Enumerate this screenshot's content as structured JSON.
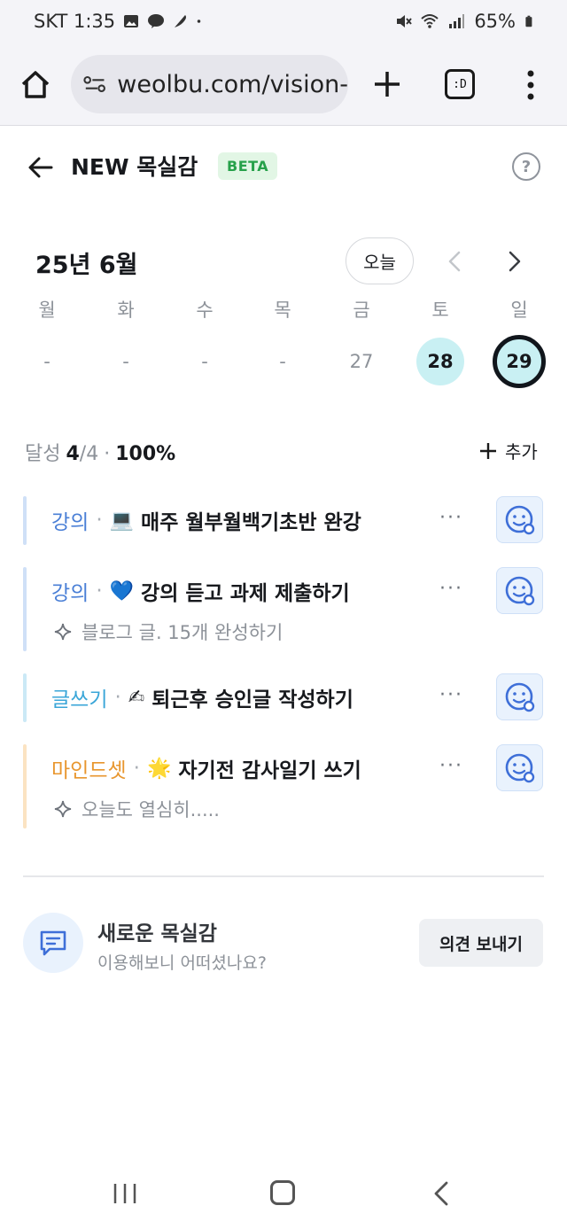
{
  "status_bar": {
    "carrier_time": "SKT 1:35",
    "battery": "65%",
    "icons": [
      "gallery-icon",
      "talk-icon",
      "feather-icon",
      "dot-icon",
      "mute-icon",
      "wifi-icon",
      "signal-icon",
      "battery-icon"
    ]
  },
  "browser": {
    "url": "weolbu.com/vision-",
    "tabs_label": ":D"
  },
  "header": {
    "title": "NEW 목실감",
    "badge": "BETA",
    "help": "?"
  },
  "calendar": {
    "month_label": "25년 6월",
    "today_button": "오늘",
    "weekdays": [
      "월",
      "화",
      "수",
      "목",
      "금",
      "토",
      "일"
    ],
    "days": [
      "-",
      "-",
      "-",
      "-",
      "27",
      "28",
      "29"
    ],
    "selected_day": "28",
    "today_day": "29",
    "accent_color": "#c9f0f3"
  },
  "progress": {
    "label": "달성",
    "done": "4",
    "total": "/4",
    "separator": "·",
    "percent": "100%",
    "add_label": "추가"
  },
  "tasks": [
    {
      "category": "강의",
      "category_color": "#4a7fd6",
      "bar_color": "#cfe0f7",
      "emoji": "💻",
      "title": "매주 월부월백기초반 완강",
      "sub": ""
    },
    {
      "category": "강의",
      "category_color": "#4a7fd6",
      "bar_color": "#cfe0f7",
      "emoji": "💙",
      "title": "강의 듣고 과제 제출하기",
      "sub": "블로그 글. 15개 완성하기"
    },
    {
      "category": "글쓰기",
      "category_color": "#3aa6d8",
      "bar_color": "#cbe9f6",
      "emoji": "✍",
      "title": "퇴근후 승인글 작성하기",
      "sub": ""
    },
    {
      "category": "마인드셋",
      "category_color": "#e8962e",
      "bar_color": "#fbe3c2",
      "emoji": "🌟",
      "title": "자기전 감사일기 쓰기",
      "sub": "오늘도 열심히....."
    }
  ],
  "task_dot": "·",
  "more_label": "···",
  "feedback": {
    "title": "새로운 목실감",
    "subtitle": "이용해보니 어떠셨나요?",
    "button": "의견 보내기"
  }
}
